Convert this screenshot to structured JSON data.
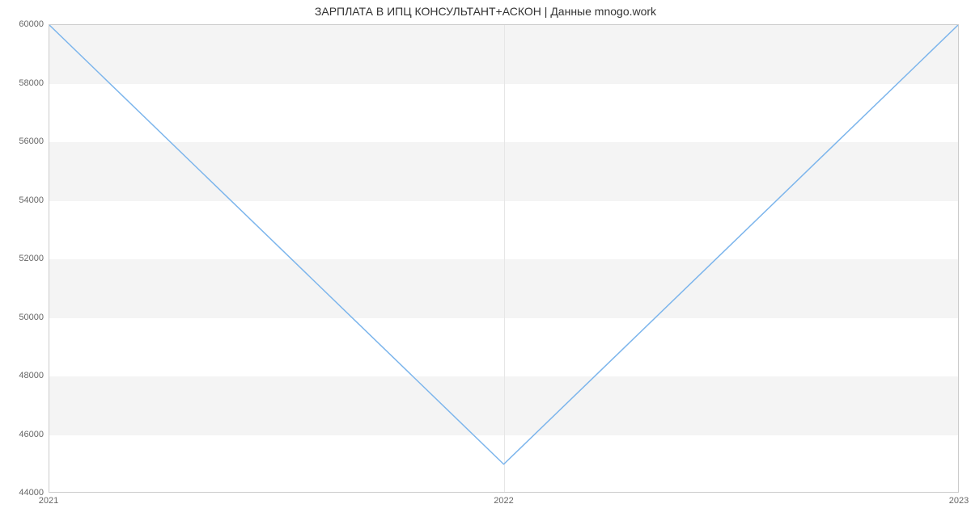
{
  "chart_data": {
    "type": "line",
    "title": "ЗАРПЛАТА В ИПЦ  КОНСУЛЬТАНТ+АСКОН | Данные mnogo.work",
    "xlabel": "",
    "ylabel": "",
    "x": [
      2021,
      2022,
      2023
    ],
    "y": [
      60000,
      45000,
      60000
    ],
    "x_ticks": [
      2021,
      2022,
      2023
    ],
    "y_ticks": [
      44000,
      46000,
      48000,
      50000,
      52000,
      54000,
      56000,
      58000,
      60000
    ],
    "ylim": [
      44000,
      60000
    ],
    "xlim": [
      2021,
      2023
    ],
    "line_color": "#7cb5ec"
  }
}
